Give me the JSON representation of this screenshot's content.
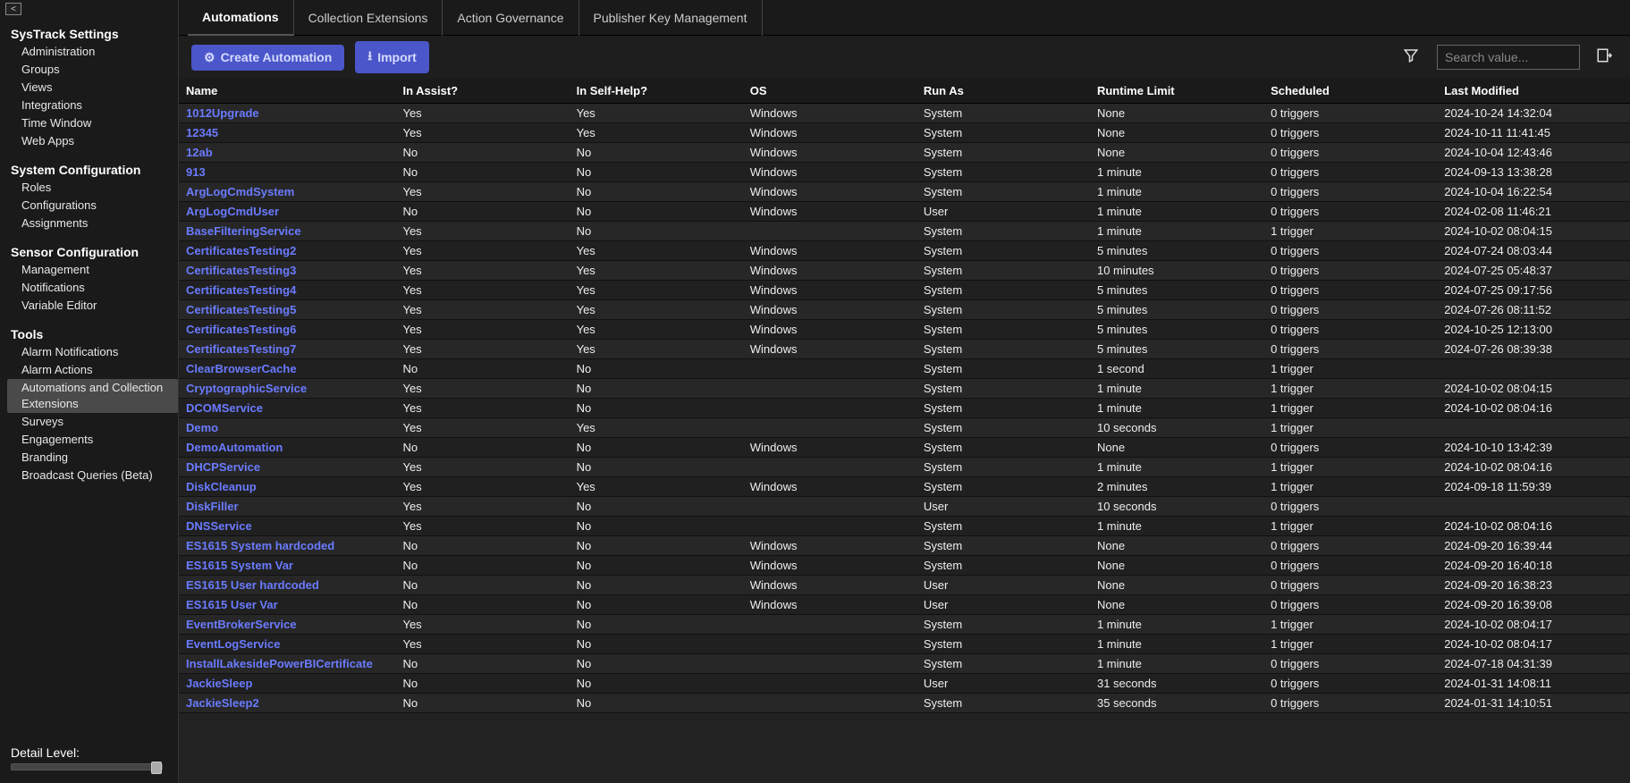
{
  "sidebar": {
    "sections": [
      {
        "heading": "SysTrack Settings",
        "items": [
          "Administration",
          "Groups",
          "Views",
          "Integrations",
          "Time Window",
          "Web Apps"
        ]
      },
      {
        "heading": "System Configuration",
        "items": [
          "Roles",
          "Configurations",
          "Assignments"
        ]
      },
      {
        "heading": "Sensor Configuration",
        "items": [
          "Management",
          "Notifications",
          "Variable Editor"
        ]
      },
      {
        "heading": "Tools",
        "items": [
          "Alarm Notifications",
          "Alarm Actions",
          "Automations and Collection Extensions",
          "Surveys",
          "Engagements",
          "Branding",
          "Broadcast Queries (Beta)"
        ],
        "selected": "Automations and Collection Extensions"
      }
    ],
    "detail_label": "Detail Level:"
  },
  "tabs": [
    "Automations",
    "Collection Extensions",
    "Action Governance",
    "Publisher Key Management"
  ],
  "active_tab": "Automations",
  "toolbar": {
    "create_label": "Create Automation",
    "import_label": "Import",
    "search_placeholder": "Search value..."
  },
  "columns": [
    "Name",
    "In Assist?",
    "In Self-Help?",
    "OS",
    "Run As",
    "Runtime Limit",
    "Scheduled",
    "Last Modified"
  ],
  "rows": [
    {
      "name": "1012Upgrade",
      "assist": "Yes",
      "self": "Yes",
      "os": "Windows",
      "runas": "System",
      "limit": "None",
      "sched": "0 triggers",
      "mod": "2024-10-24 14:32:04"
    },
    {
      "name": "12345",
      "assist": "Yes",
      "self": "Yes",
      "os": "Windows",
      "runas": "System",
      "limit": "None",
      "sched": "0 triggers",
      "mod": "2024-10-11 11:41:45"
    },
    {
      "name": "12ab",
      "assist": "No",
      "self": "No",
      "os": "Windows",
      "runas": "System",
      "limit": "None",
      "sched": "0 triggers",
      "mod": "2024-10-04 12:43:46"
    },
    {
      "name": "913",
      "assist": "No",
      "self": "No",
      "os": "Windows",
      "runas": "System",
      "limit": "1 minute",
      "sched": "0 triggers",
      "mod": "2024-09-13 13:38:28"
    },
    {
      "name": "ArgLogCmdSystem",
      "assist": "Yes",
      "self": "No",
      "os": "Windows",
      "runas": "System",
      "limit": "1 minute",
      "sched": "0 triggers",
      "mod": "2024-10-04 16:22:54"
    },
    {
      "name": "ArgLogCmdUser",
      "assist": "No",
      "self": "No",
      "os": "Windows",
      "runas": "User",
      "limit": "1 minute",
      "sched": "0 triggers",
      "mod": "2024-02-08 11:46:21"
    },
    {
      "name": "BaseFilteringService",
      "assist": "Yes",
      "self": "No",
      "os": "",
      "runas": "System",
      "limit": "1 minute",
      "sched": "1 trigger",
      "mod": "2024-10-02 08:04:15"
    },
    {
      "name": "CertificatesTesting2",
      "assist": "Yes",
      "self": "Yes",
      "os": "Windows",
      "runas": "System",
      "limit": "5 minutes",
      "sched": "0 triggers",
      "mod": "2024-07-24 08:03:44"
    },
    {
      "name": "CertificatesTesting3",
      "assist": "Yes",
      "self": "Yes",
      "os": "Windows",
      "runas": "System",
      "limit": "10 minutes",
      "sched": "0 triggers",
      "mod": "2024-07-25 05:48:37"
    },
    {
      "name": "CertificatesTesting4",
      "assist": "Yes",
      "self": "Yes",
      "os": "Windows",
      "runas": "System",
      "limit": "5 minutes",
      "sched": "0 triggers",
      "mod": "2024-07-25 09:17:56"
    },
    {
      "name": "CertificatesTesting5",
      "assist": "Yes",
      "self": "Yes",
      "os": "Windows",
      "runas": "System",
      "limit": "5 minutes",
      "sched": "0 triggers",
      "mod": "2024-07-26 08:11:52"
    },
    {
      "name": "CertificatesTesting6",
      "assist": "Yes",
      "self": "Yes",
      "os": "Windows",
      "runas": "System",
      "limit": "5 minutes",
      "sched": "0 triggers",
      "mod": "2024-10-25 12:13:00"
    },
    {
      "name": "CertificatesTesting7",
      "assist": "Yes",
      "self": "Yes",
      "os": "Windows",
      "runas": "System",
      "limit": "5 minutes",
      "sched": "0 triggers",
      "mod": "2024-07-26 08:39:38"
    },
    {
      "name": "ClearBrowserCache",
      "assist": "No",
      "self": "No",
      "os": "",
      "runas": "System",
      "limit": "1 second",
      "sched": "1 trigger",
      "mod": ""
    },
    {
      "name": "CryptographicService",
      "assist": "Yes",
      "self": "No",
      "os": "",
      "runas": "System",
      "limit": "1 minute",
      "sched": "1 trigger",
      "mod": "2024-10-02 08:04:15"
    },
    {
      "name": "DCOMService",
      "assist": "Yes",
      "self": "No",
      "os": "",
      "runas": "System",
      "limit": "1 minute",
      "sched": "1 trigger",
      "mod": "2024-10-02 08:04:16"
    },
    {
      "name": "Demo",
      "assist": "Yes",
      "self": "Yes",
      "os": "",
      "runas": "System",
      "limit": "10 seconds",
      "sched": "1 trigger",
      "mod": ""
    },
    {
      "name": "DemoAutomation",
      "assist": "No",
      "self": "No",
      "os": "Windows",
      "runas": "System",
      "limit": "None",
      "sched": "0 triggers",
      "mod": "2024-10-10 13:42:39"
    },
    {
      "name": "DHCPService",
      "assist": "Yes",
      "self": "No",
      "os": "",
      "runas": "System",
      "limit": "1 minute",
      "sched": "1 trigger",
      "mod": "2024-10-02 08:04:16"
    },
    {
      "name": "DiskCleanup",
      "assist": "Yes",
      "self": "Yes",
      "os": "Windows",
      "runas": "System",
      "limit": "2 minutes",
      "sched": "1 trigger",
      "mod": "2024-09-18 11:59:39"
    },
    {
      "name": "DiskFiller",
      "assist": "Yes",
      "self": "No",
      "os": "",
      "runas": "User",
      "limit": "10 seconds",
      "sched": "0 triggers",
      "mod": ""
    },
    {
      "name": "DNSService",
      "assist": "Yes",
      "self": "No",
      "os": "",
      "runas": "System",
      "limit": "1 minute",
      "sched": "1 trigger",
      "mod": "2024-10-02 08:04:16"
    },
    {
      "name": "ES1615 System hardcoded",
      "assist": "No",
      "self": "No",
      "os": "Windows",
      "runas": "System",
      "limit": "None",
      "sched": "0 triggers",
      "mod": "2024-09-20 16:39:44"
    },
    {
      "name": "ES1615 System Var",
      "assist": "No",
      "self": "No",
      "os": "Windows",
      "runas": "System",
      "limit": "None",
      "sched": "0 triggers",
      "mod": "2024-09-20 16:40:18"
    },
    {
      "name": "ES1615 User hardcoded",
      "assist": "No",
      "self": "No",
      "os": "Windows",
      "runas": "User",
      "limit": "None",
      "sched": "0 triggers",
      "mod": "2024-09-20 16:38:23"
    },
    {
      "name": "ES1615 User Var",
      "assist": "No",
      "self": "No",
      "os": "Windows",
      "runas": "User",
      "limit": "None",
      "sched": "0 triggers",
      "mod": "2024-09-20 16:39:08"
    },
    {
      "name": "EventBrokerService",
      "assist": "Yes",
      "self": "No",
      "os": "",
      "runas": "System",
      "limit": "1 minute",
      "sched": "1 trigger",
      "mod": "2024-10-02 08:04:17"
    },
    {
      "name": "EventLogService",
      "assist": "Yes",
      "self": "No",
      "os": "",
      "runas": "System",
      "limit": "1 minute",
      "sched": "1 trigger",
      "mod": "2024-10-02 08:04:17"
    },
    {
      "name": "InstallLakesidePowerBICertificate",
      "assist": "No",
      "self": "No",
      "os": "",
      "runas": "System",
      "limit": "1 minute",
      "sched": "0 triggers",
      "mod": "2024-07-18 04:31:39"
    },
    {
      "name": "JackieSleep",
      "assist": "No",
      "self": "No",
      "os": "",
      "runas": "User",
      "limit": "31 seconds",
      "sched": "0 triggers",
      "mod": "2024-01-31 14:08:11"
    },
    {
      "name": "JackieSleep2",
      "assist": "No",
      "self": "No",
      "os": "",
      "runas": "System",
      "limit": "35 seconds",
      "sched": "0 triggers",
      "mod": "2024-01-31 14:10:51"
    }
  ]
}
